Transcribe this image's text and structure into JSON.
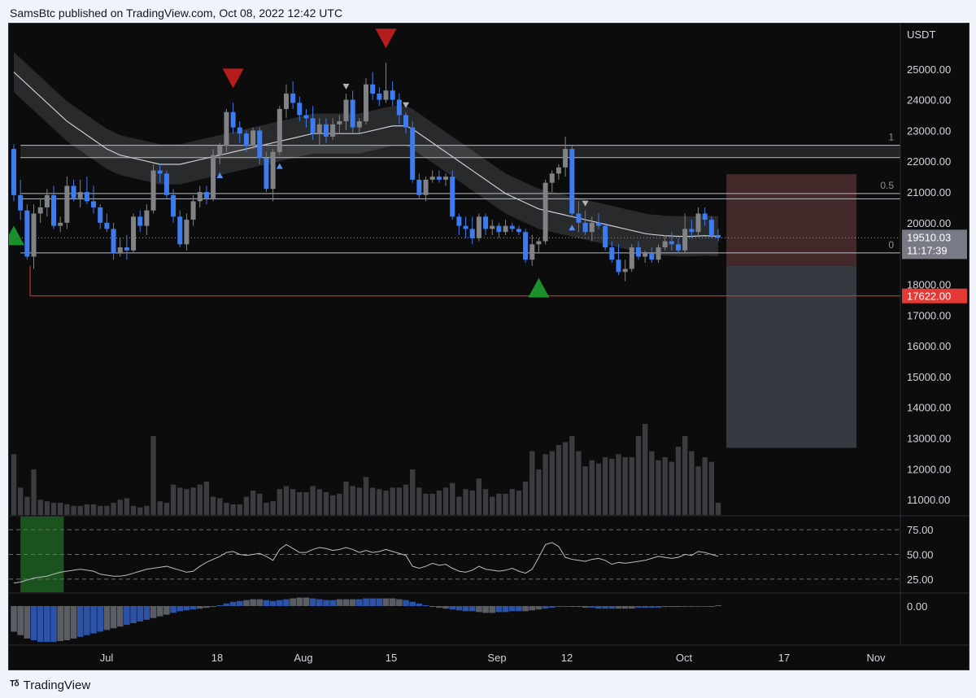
{
  "header": {
    "publish_line": "SamsBtc published on TradingView.com, Oct 08, 2022 12:42 UTC"
  },
  "footer": {
    "brand": "TradingView",
    "logo_icon": "tradingview-logo-icon"
  },
  "colors": {
    "background": "#0c0c0d",
    "candle_up": "#808285",
    "candle_down": "#3d7cf0",
    "signal_down": "#b71c1c",
    "signal_up": "#1a8f2a",
    "stop_line": "#e53935",
    "target_zone": "#3a3f47",
    "stop_zone": "#4a2c2e"
  },
  "chart_data": {
    "type": "candlestick",
    "symbol_currency": "USDT",
    "timeframe": "1D",
    "price_axis": {
      "ylim": [
        10500,
        26000
      ],
      "ticks": [
        "25000.00",
        "24000.00",
        "23000.00",
        "22000.00",
        "21000.00",
        "20000.00",
        "19000.00",
        "18000.00",
        "17000.00",
        "16000.00",
        "15000.00",
        "14000.00",
        "13000.00",
        "12000.00",
        "11000.00"
      ],
      "last_price": "19510.03",
      "countdown": "11:17:39",
      "marked_level": "17622.00"
    },
    "time_axis": {
      "labels": [
        "Jul",
        "18",
        "Aug",
        "15",
        "Sep",
        "12",
        "Oct",
        "17",
        "Nov"
      ]
    },
    "fib_levels": [
      {
        "label": "1",
        "price": 22520
      },
      {
        "label": "0.5",
        "price": 20950
      },
      {
        "label": "0",
        "price": 19020
      }
    ],
    "support_lines": [
      22120,
      20780
    ],
    "stop_level": 17622,
    "position": {
      "entry": 18600,
      "stop": 21580,
      "target": 12680
    },
    "candles": [
      [
        22400,
        22550,
        20700,
        20900
      ],
      [
        20900,
        21400,
        20100,
        20400
      ],
      [
        20400,
        20600,
        18800,
        18900
      ],
      [
        18900,
        20600,
        18500,
        20300
      ],
      [
        20300,
        20800,
        20000,
        20500
      ],
      [
        20500,
        21100,
        20200,
        20900
      ],
      [
        20900,
        21200,
        19800,
        19900
      ],
      [
        19900,
        20200,
        19700,
        20000
      ],
      [
        20000,
        21500,
        19800,
        21200
      ],
      [
        21200,
        21400,
        20700,
        20800
      ],
      [
        20800,
        21400,
        20500,
        21000
      ],
      [
        21000,
        21500,
        20600,
        20700
      ],
      [
        20700,
        21200,
        20300,
        20500
      ],
      [
        20500,
        20600,
        19800,
        20000
      ],
      [
        20000,
        20300,
        19700,
        19800
      ],
      [
        19800,
        20000,
        18800,
        19000
      ],
      [
        19000,
        19500,
        18900,
        19200
      ],
      [
        19200,
        19600,
        18800,
        19100
      ],
      [
        19100,
        20300,
        19000,
        20200
      ],
      [
        20200,
        20400,
        19700,
        19900
      ],
      [
        19900,
        20600,
        19600,
        20400
      ],
      [
        20400,
        21900,
        20300,
        21700
      ],
      [
        21700,
        21900,
        21300,
        21600
      ],
      [
        21600,
        21700,
        20800,
        20900
      ],
      [
        20900,
        21100,
        20000,
        20200
      ],
      [
        20200,
        20400,
        19200,
        19300
      ],
      [
        19300,
        20300,
        19100,
        20100
      ],
      [
        20100,
        20900,
        19900,
        20700
      ],
      [
        20700,
        21200,
        20500,
        21000
      ],
      [
        21000,
        21200,
        20600,
        20800
      ],
      [
        20800,
        22400,
        20700,
        22200
      ],
      [
        22200,
        22600,
        21900,
        22500
      ],
      [
        22500,
        23700,
        22300,
        23600
      ],
      [
        23600,
        23900,
        22900,
        23100
      ],
      [
        23100,
        23300,
        22600,
        22900
      ],
      [
        22900,
        23000,
        22300,
        22500
      ],
      [
        22500,
        23100,
        22400,
        23000
      ],
      [
        23000,
        23100,
        21900,
        22100
      ],
      [
        22100,
        22300,
        21000,
        21100
      ],
      [
        21100,
        22400,
        20700,
        22300
      ],
      [
        22300,
        23800,
        22200,
        23700
      ],
      [
        23700,
        24500,
        23400,
        24200
      ],
      [
        24200,
        24600,
        23700,
        23900
      ],
      [
        23900,
        24100,
        23300,
        23500
      ],
      [
        23500,
        23700,
        23100,
        23400
      ],
      [
        23400,
        23800,
        22700,
        22900
      ],
      [
        22900,
        23400,
        22500,
        23200
      ],
      [
        23200,
        23400,
        22600,
        22800
      ],
      [
        22800,
        23400,
        22700,
        23200
      ],
      [
        23200,
        23500,
        22900,
        23300
      ],
      [
        23300,
        24200,
        23000,
        24000
      ],
      [
        24000,
        24300,
        22900,
        23100
      ],
      [
        23100,
        23400,
        22900,
        23300
      ],
      [
        23300,
        24700,
        23200,
        24500
      ],
      [
        24500,
        24900,
        24000,
        24200
      ],
      [
        24200,
        24400,
        23800,
        24000
      ],
      [
        24000,
        25200,
        23900,
        24300
      ],
      [
        24300,
        24600,
        23800,
        24000
      ],
      [
        24000,
        24200,
        23200,
        23500
      ],
      [
        23500,
        23600,
        22900,
        23100
      ],
      [
        23100,
        23300,
        21300,
        21400
      ],
      [
        21400,
        21600,
        20800,
        20900
      ],
      [
        20900,
        21500,
        20700,
        21400
      ],
      [
        21400,
        21700,
        21300,
        21500
      ],
      [
        21500,
        21700,
        21300,
        21400
      ],
      [
        21400,
        21600,
        21200,
        21500
      ],
      [
        21500,
        21700,
        20100,
        20200
      ],
      [
        20200,
        20300,
        19600,
        19900
      ],
      [
        19900,
        20200,
        19500,
        19800
      ],
      [
        19800,
        20200,
        19300,
        19500
      ],
      [
        19500,
        20300,
        19400,
        20200
      ],
      [
        20200,
        20300,
        19600,
        19800
      ],
      [
        19800,
        20100,
        19600,
        19900
      ],
      [
        19900,
        20000,
        19500,
        19700
      ],
      [
        19700,
        20100,
        19600,
        19900
      ],
      [
        19900,
        20000,
        19700,
        19800
      ],
      [
        19800,
        19900,
        19600,
        19700
      ],
      [
        19700,
        19800,
        18700,
        18800
      ],
      [
        18800,
        19600,
        18600,
        19300
      ],
      [
        19300,
        19500,
        19000,
        19400
      ],
      [
        19400,
        21400,
        19300,
        21300
      ],
      [
        21300,
        21700,
        21000,
        21600
      ],
      [
        21600,
        21900,
        21400,
        21800
      ],
      [
        21800,
        22800,
        21500,
        22400
      ],
      [
        22400,
        22500,
        20200,
        20300
      ],
      [
        20300,
        20700,
        19700,
        20000
      ],
      [
        20000,
        20400,
        19600,
        19700
      ],
      [
        19700,
        20200,
        19400,
        20000
      ],
      [
        20000,
        20300,
        19800,
        19900
      ],
      [
        19900,
        20000,
        19100,
        19200
      ],
      [
        19200,
        19400,
        18700,
        18800
      ],
      [
        18800,
        19300,
        18300,
        18400
      ],
      [
        18400,
        18800,
        18100,
        18500
      ],
      [
        18500,
        19300,
        18400,
        19200
      ],
      [
        19200,
        19400,
        18800,
        18900
      ],
      [
        18900,
        19100,
        18700,
        19000
      ],
      [
        19000,
        19200,
        18700,
        18800
      ],
      [
        18800,
        19300,
        18700,
        19200
      ],
      [
        19200,
        19600,
        19100,
        19400
      ],
      [
        19400,
        19700,
        19100,
        19300
      ],
      [
        19300,
        19500,
        19000,
        19100
      ],
      [
        19100,
        20300,
        19000,
        19800
      ],
      [
        19800,
        20100,
        19500,
        19700
      ],
      [
        19700,
        20500,
        19600,
        20300
      ],
      [
        20300,
        20500,
        19900,
        20100
      ],
      [
        20100,
        20200,
        19500,
        19600
      ],
      [
        19600,
        19800,
        19400,
        19510
      ]
    ],
    "ema": [
      24900,
      24700,
      24500,
      24300,
      24100,
      23900,
      23700,
      23500,
      23300,
      23150,
      23000,
      22850,
      22700,
      22550,
      22400,
      22300,
      22200,
      22150,
      22100,
      22050,
      22000,
      21950,
      21900,
      21900,
      21900,
      21900,
      21950,
      22000,
      22050,
      22100,
      22150,
      22200,
      22250,
      22300,
      22350,
      22400,
      22450,
      22500,
      22550,
      22600,
      22650,
      22700,
      22750,
      22800,
      22850,
      22900,
      22900,
      22900,
      22900,
      22900,
      22900,
      22900,
      22900,
      22950,
      23000,
      23050,
      23100,
      23150,
      23150,
      23150,
      23050,
      22900,
      22750,
      22600,
      22450,
      22300,
      22150,
      22000,
      21850,
      21700,
      21550,
      21400,
      21250,
      21100,
      20950,
      20850,
      20750,
      20650,
      20550,
      20450,
      20400,
      20350,
      20300,
      20250,
      20200,
      20150,
      20100,
      20050,
      20000,
      19950,
      19900,
      19850,
      19800,
      19750,
      19700,
      19650,
      19620,
      19600,
      19580,
      19570,
      19560,
      19560,
      19560,
      19570,
      19580,
      19570,
      19560
    ],
    "signals": [
      {
        "type": "sell-big",
        "index": 33
      },
      {
        "type": "sell-big",
        "index": 56
      },
      {
        "type": "sell-small",
        "index": 50
      },
      {
        "type": "sell-small",
        "index": 59
      },
      {
        "type": "sell-small",
        "index": 86
      },
      {
        "type": "buy-big",
        "index": 0
      },
      {
        "type": "buy-big",
        "index": 79
      },
      {
        "type": "buy-small",
        "index": 31
      },
      {
        "type": "buy-small",
        "index": 40
      },
      {
        "type": "buy-small",
        "index": 84
      }
    ],
    "volume": [
      40,
      18,
      12,
      30,
      10,
      9,
      8,
      8,
      7,
      6,
      6,
      7,
      7,
      6,
      6,
      8,
      10,
      11,
      6,
      5,
      6,
      52,
      9,
      8,
      20,
      18,
      17,
      18,
      20,
      22,
      12,
      11,
      8,
      7,
      7,
      12,
      16,
      14,
      8,
      9,
      17,
      19,
      17,
      15,
      15,
      19,
      17,
      15,
      13,
      14,
      22,
      19,
      18,
      25,
      18,
      17,
      16,
      18,
      18,
      20,
      30,
      18,
      14,
      14,
      16,
      18,
      21,
      12,
      17,
      16,
      24,
      17,
      12,
      14,
      14,
      17,
      16,
      22,
      42,
      30,
      40,
      42,
      46,
      48,
      52,
      42,
      32,
      36,
      34,
      38,
      37,
      40,
      38,
      38,
      52,
      60,
      42,
      36,
      38,
      35,
      45,
      52,
      42,
      32,
      38,
      35,
      8
    ],
    "rsi": {
      "ticks": [
        "75.00",
        "50.00",
        "25.00"
      ],
      "levels": [
        75,
        50,
        25
      ],
      "values": [
        21,
        22,
        24,
        26,
        27,
        28,
        30,
        32,
        33,
        34,
        35,
        34,
        33,
        30,
        29,
        28,
        28,
        29,
        31,
        33,
        35,
        36,
        37,
        38,
        36,
        34,
        32,
        33,
        38,
        42,
        45,
        48,
        52,
        53,
        50,
        49,
        50,
        51,
        48,
        44,
        55,
        60,
        56,
        52,
        52,
        55,
        57,
        56,
        54,
        55,
        57,
        55,
        52,
        54,
        52,
        53,
        55,
        53,
        51,
        49,
        38,
        36,
        38,
        41,
        39,
        40,
        36,
        33,
        32,
        34,
        38,
        35,
        34,
        33,
        34,
        36,
        33,
        31,
        35,
        47,
        60,
        62,
        58,
        47,
        45,
        44,
        43,
        45,
        46,
        44,
        40,
        42,
        41,
        42,
        43,
        44,
        46,
        48,
        47,
        46,
        47,
        50,
        49,
        53,
        52,
        50,
        48
      ]
    },
    "momentum_histogram": {
      "zero_label": "0.00",
      "values": [
        -30,
        -34,
        -38,
        -40,
        -42,
        -42,
        -42,
        -41,
        -40,
        -38,
        -36,
        -34,
        -32,
        -30,
        -28,
        -26,
        -24,
        -22,
        -20,
        -18,
        -16,
        -14,
        -12,
        -10,
        -8,
        -6,
        -5,
        -4,
        -3,
        -2,
        -1,
        1,
        3,
        5,
        6,
        7,
        8,
        8,
        7,
        6,
        7,
        8,
        9,
        10,
        10,
        9,
        8,
        7,
        7,
        8,
        8,
        8,
        8,
        9,
        9,
        9,
        9,
        9,
        8,
        7,
        5,
        3,
        1,
        -1,
        -2,
        -3,
        -4,
        -5,
        -6,
        -6,
        -7,
        -8,
        -8,
        -7,
        -7,
        -6,
        -6,
        -6,
        -5,
        -4,
        -3,
        -2,
        -1,
        -1,
        0,
        -1,
        -2,
        -2,
        -3,
        -3,
        -3,
        -3,
        -3,
        -3,
        -2,
        -2,
        -2,
        -2,
        -1,
        -1,
        -1,
        -1,
        -1,
        0,
        0,
        0,
        1
      ]
    }
  }
}
